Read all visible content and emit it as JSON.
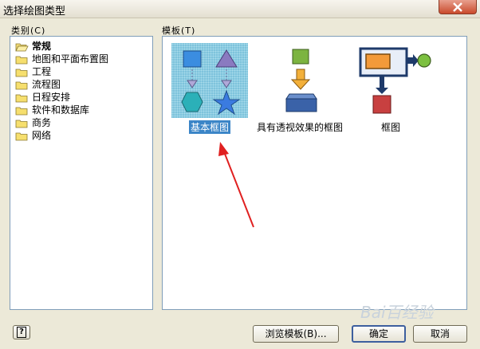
{
  "window": {
    "title": "选择绘图类型"
  },
  "categories": {
    "label": "类别(C)",
    "items": [
      {
        "label": "常规",
        "open": true
      },
      {
        "label": "地图和平面布置图",
        "open": false
      },
      {
        "label": "工程",
        "open": false
      },
      {
        "label": "流程图",
        "open": false
      },
      {
        "label": "日程安排",
        "open": false
      },
      {
        "label": "软件和数据库",
        "open": false
      },
      {
        "label": "商务",
        "open": false
      },
      {
        "label": "网络",
        "open": false
      }
    ]
  },
  "templates": {
    "label": "模板(T)",
    "items": [
      {
        "label": "基本框图",
        "selected": true,
        "icon": "basic-block-diagram-icon"
      },
      {
        "label": "具有透视效果的框图",
        "selected": false,
        "icon": "perspective-block-diagram-icon"
      },
      {
        "label": "框图",
        "selected": false,
        "icon": "block-diagram-icon"
      }
    ]
  },
  "buttons": {
    "browse": "浏览模板(B)...",
    "ok": "确定",
    "cancel": "取消"
  },
  "watermark": "Bai百经验",
  "colors": {
    "selection": "#3b85c7",
    "panel_border": "#7f9db9",
    "arrow": "#e02020"
  }
}
